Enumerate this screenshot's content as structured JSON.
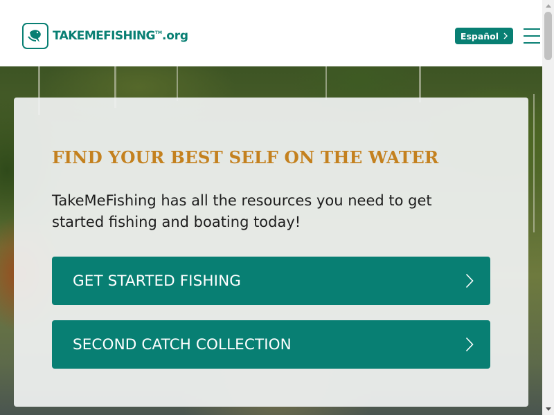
{
  "header": {
    "logo": {
      "text": "TAKEMEFISHING",
      "tm": "TM",
      "org": ".org"
    },
    "language_button": {
      "label": "Español"
    },
    "menu_button": {
      "icon": "hamburger-menu-icon"
    }
  },
  "hero": {
    "title": "FIND YOUR BEST SELF ON THE WATER",
    "body": "TakeMeFishing has all the resources you need to get started fishing and boating today!",
    "ctas": [
      {
        "label": "GET STARTED FISHING",
        "icon": "chevron-right-icon"
      },
      {
        "label": "SECOND CATCH COLLECTION",
        "icon": "chevron-right-icon"
      }
    ]
  },
  "colors": {
    "brand_teal": "#087f73",
    "title_gold": "#c4811f",
    "body_text": "#1d1d1d",
    "card_bg": "#f0f2f2"
  }
}
